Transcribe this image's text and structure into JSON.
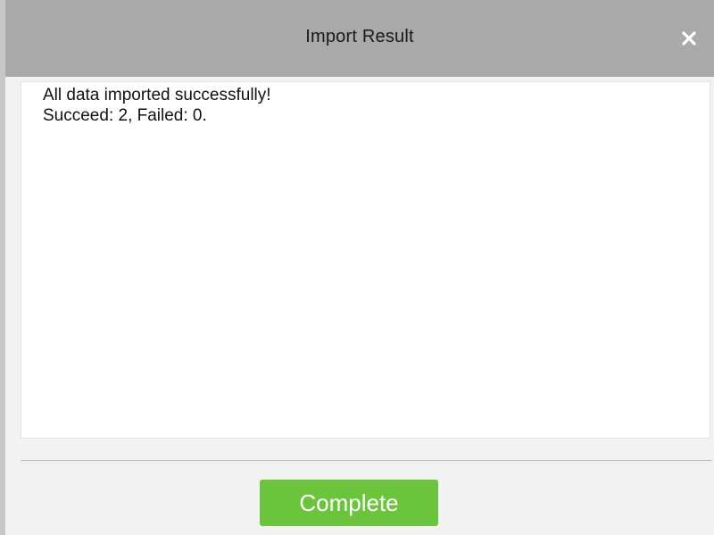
{
  "dialog": {
    "title": "Import Result",
    "close_icon": "close-icon"
  },
  "content": {
    "message_line_1": "All data imported successfully!",
    "message_line_2": "Succeed: 2, Failed: 0."
  },
  "footer": {
    "complete_label": "Complete"
  },
  "colors": {
    "title_bar": "#a7a9ab",
    "complete_button": "#6cc33c",
    "panel_background": "#ffffff"
  }
}
